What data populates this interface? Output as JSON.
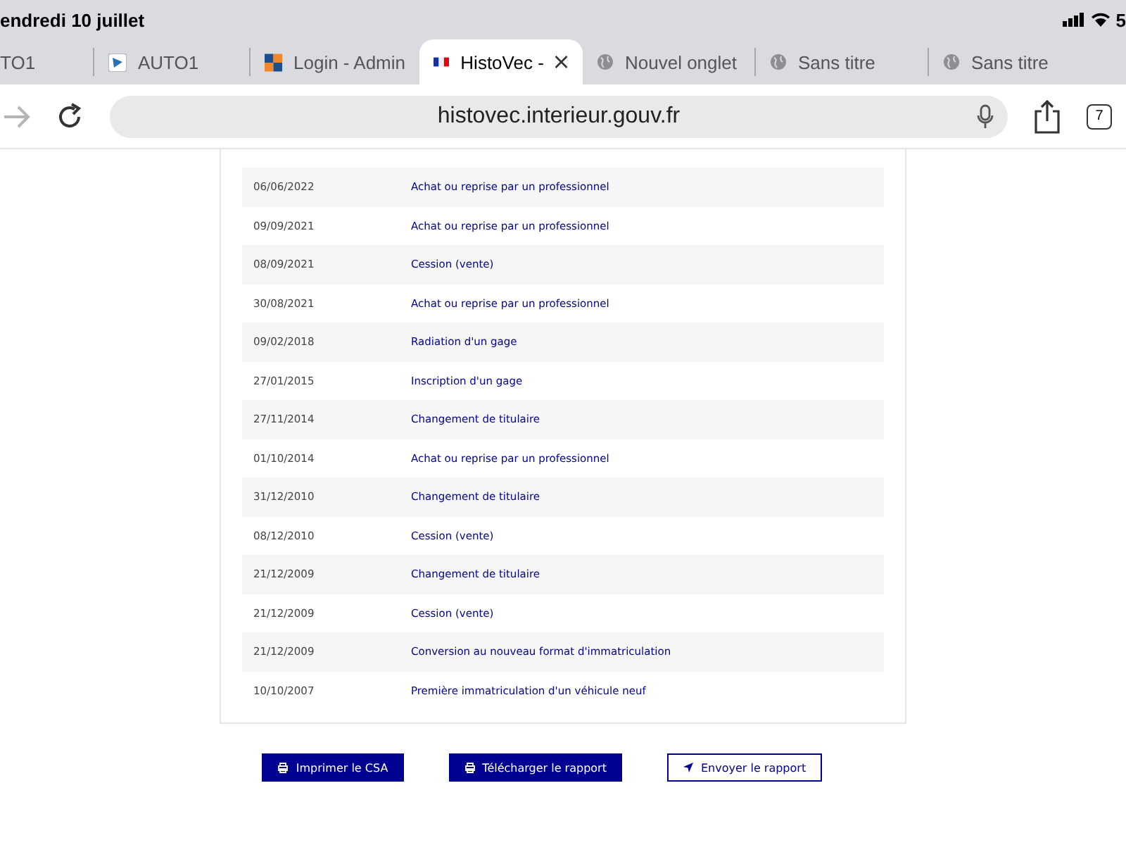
{
  "status_bar": {
    "date": "endredi 10 juillet",
    "battery": "5"
  },
  "tabs": [
    {
      "label": "TO1",
      "kind": "plain",
      "selected": false
    },
    {
      "label": "AUTO1",
      "kind": "app",
      "selected": false
    },
    {
      "label": "Login - Admin",
      "kind": "squares",
      "selected": false
    },
    {
      "label": "HistoVec -",
      "kind": "flag",
      "selected": true
    },
    {
      "label": "Nouvel onglet",
      "kind": "blank",
      "selected": false
    },
    {
      "label": "Sans titre",
      "kind": "blank",
      "selected": false
    },
    {
      "label": "Sans titre",
      "kind": "blank",
      "selected": false
    }
  ],
  "address_bar": {
    "url": "histovec.interieur.gouv.fr",
    "tab_count": "7"
  },
  "history": [
    {
      "date": "06/06/2022",
      "event": "Achat ou reprise par un professionnel"
    },
    {
      "date": "09/09/2021",
      "event": "Achat ou reprise par un professionnel"
    },
    {
      "date": "08/09/2021",
      "event": "Cession (vente)"
    },
    {
      "date": "30/08/2021",
      "event": "Achat ou reprise par un professionnel"
    },
    {
      "date": "09/02/2018",
      "event": "Radiation d'un gage"
    },
    {
      "date": "27/01/2015",
      "event": "Inscription d'un gage"
    },
    {
      "date": "27/11/2014",
      "event": "Changement de titulaire"
    },
    {
      "date": "01/10/2014",
      "event": "Achat ou reprise par un professionnel"
    },
    {
      "date": "31/12/2010",
      "event": "Changement de titulaire"
    },
    {
      "date": "08/12/2010",
      "event": "Cession (vente)"
    },
    {
      "date": "21/12/2009",
      "event": "Changement de titulaire"
    },
    {
      "date": "21/12/2009",
      "event": "Cession (vente)"
    },
    {
      "date": "21/12/2009",
      "event": "Conversion au nouveau format d'immatriculation"
    },
    {
      "date": "10/10/2007",
      "event": "Première immatriculation d'un véhicule neuf"
    }
  ],
  "actions": [
    {
      "label": "Imprimer le CSA",
      "kind": "print",
      "primary": true
    },
    {
      "label": "Télécharger le rapport",
      "kind": "print",
      "primary": true
    },
    {
      "label": "Envoyer le rapport",
      "kind": "send",
      "primary": false
    }
  ]
}
